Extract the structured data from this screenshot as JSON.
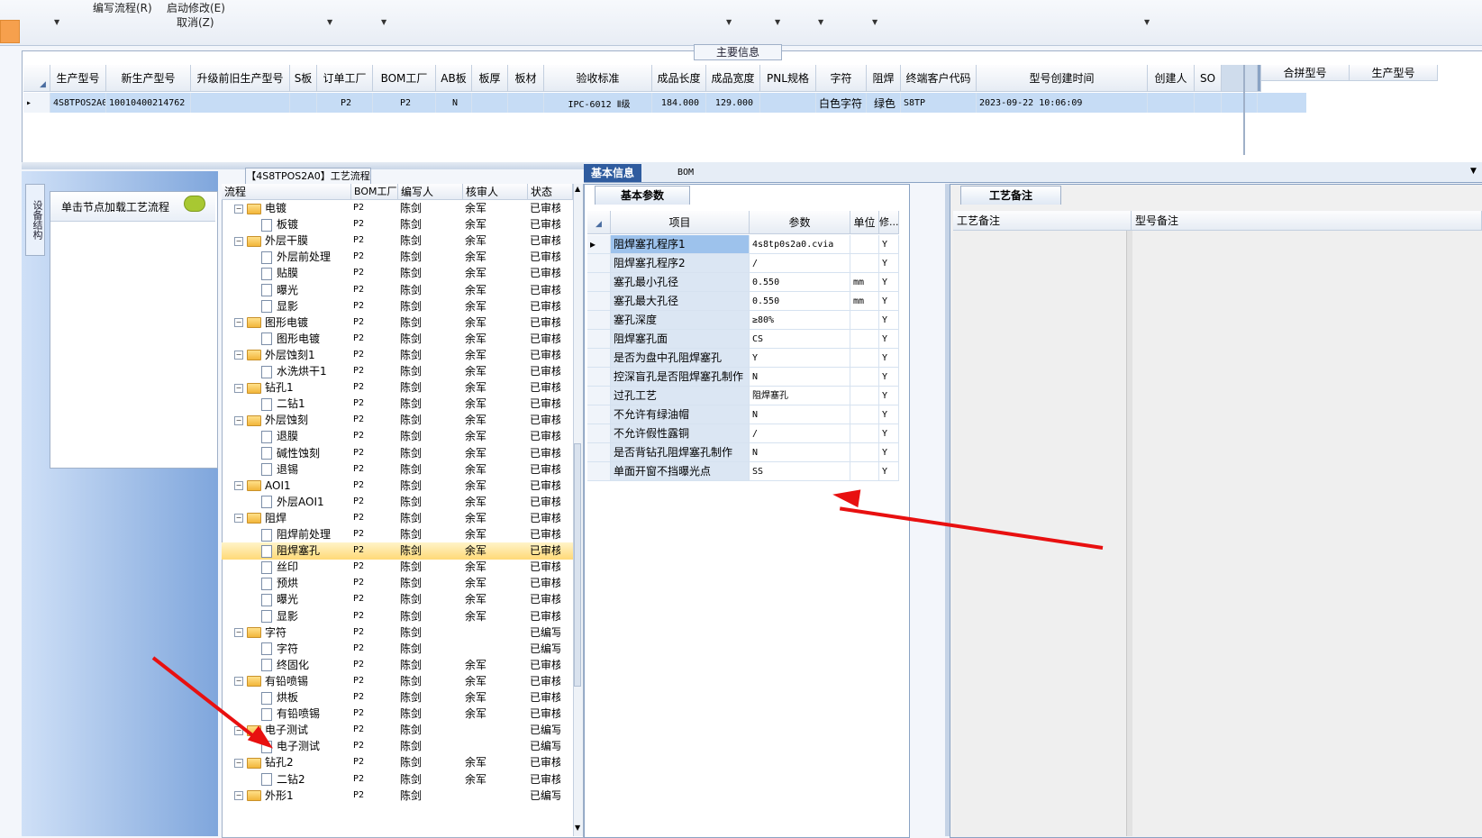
{
  "toolbar": {
    "items": [
      "编写流程(R)",
      "启动修改(E)",
      "取消(Z)"
    ]
  },
  "main_info": {
    "title": "主要信息",
    "columns": [
      "生产型号",
      "新生产型号",
      "升级前旧生产型号",
      "S板",
      "订单工厂",
      "BOM工厂",
      "AB板",
      "板厚",
      "板材",
      "验收标准",
      "成品长度",
      "成品宽度",
      "PNL规格",
      "字符",
      "阻焊",
      "终端客户代码",
      "型号创建时间",
      "创建人",
      "SO"
    ],
    "row": [
      "4S8TPOS2A0",
      "10010400214762",
      "",
      "",
      "P2",
      "P2",
      "N",
      "",
      "",
      "IPC-6012 Ⅱ级",
      "184.000",
      "129.000",
      "",
      "白色字符",
      "绿色",
      "S8TP",
      "2023-09-22 10:06:09",
      "",
      ""
    ],
    "side_columns": [
      "合拼型号",
      "生产型号"
    ]
  },
  "left_panel": {
    "vertical_tab": "设备结构",
    "load_hint": "单击节点加载工艺流程",
    "hint_icon": "speech-bubble-icon"
  },
  "process_tree": {
    "title": "【4S8TPOS2A0】工艺流程",
    "columns": [
      "流程",
      "BOM工厂",
      "编写人",
      "核审人",
      "状态"
    ],
    "rows": [
      {
        "kind": "folder",
        "name": "电镀",
        "bom": "P2",
        "writer": "陈剑",
        "reviewer": "余军",
        "status": "已审核"
      },
      {
        "kind": "doc",
        "name": "板镀",
        "bom": "P2",
        "writer": "陈剑",
        "reviewer": "余军",
        "status": "已审核"
      },
      {
        "kind": "folder",
        "name": "外层干膜",
        "bom": "P2",
        "writer": "陈剑",
        "reviewer": "余军",
        "status": "已审核"
      },
      {
        "kind": "doc",
        "name": "外层前处理",
        "bom": "P2",
        "writer": "陈剑",
        "reviewer": "余军",
        "status": "已审核"
      },
      {
        "kind": "doc",
        "name": "贴膜",
        "bom": "P2",
        "writer": "陈剑",
        "reviewer": "余军",
        "status": "已审核"
      },
      {
        "kind": "doc",
        "name": "曝光",
        "bom": "P2",
        "writer": "陈剑",
        "reviewer": "余军",
        "status": "已审核"
      },
      {
        "kind": "doc",
        "name": "显影",
        "bom": "P2",
        "writer": "陈剑",
        "reviewer": "余军",
        "status": "已审核"
      },
      {
        "kind": "folder",
        "name": "图形电镀",
        "bom": "P2",
        "writer": "陈剑",
        "reviewer": "余军",
        "status": "已审核"
      },
      {
        "kind": "doc",
        "name": "图形电镀",
        "bom": "P2",
        "writer": "陈剑",
        "reviewer": "余军",
        "status": "已审核"
      },
      {
        "kind": "folder",
        "name": "外层蚀刻1",
        "bom": "P2",
        "writer": "陈剑",
        "reviewer": "余军",
        "status": "已审核"
      },
      {
        "kind": "doc",
        "name": "水洗烘干1",
        "bom": "P2",
        "writer": "陈剑",
        "reviewer": "余军",
        "status": "已审核"
      },
      {
        "kind": "folder",
        "name": "钻孔1",
        "bom": "P2",
        "writer": "陈剑",
        "reviewer": "余军",
        "status": "已审核"
      },
      {
        "kind": "doc",
        "name": "二钻1",
        "bom": "P2",
        "writer": "陈剑",
        "reviewer": "余军",
        "status": "已审核"
      },
      {
        "kind": "folder",
        "name": "外层蚀刻",
        "bom": "P2",
        "writer": "陈剑",
        "reviewer": "余军",
        "status": "已审核"
      },
      {
        "kind": "doc",
        "name": "退膜",
        "bom": "P2",
        "writer": "陈剑",
        "reviewer": "余军",
        "status": "已审核"
      },
      {
        "kind": "doc",
        "name": "碱性蚀刻",
        "bom": "P2",
        "writer": "陈剑",
        "reviewer": "余军",
        "status": "已审核"
      },
      {
        "kind": "doc",
        "name": "退锡",
        "bom": "P2",
        "writer": "陈剑",
        "reviewer": "余军",
        "status": "已审核"
      },
      {
        "kind": "folder",
        "name": "AOI1",
        "bom": "P2",
        "writer": "陈剑",
        "reviewer": "余军",
        "status": "已审核"
      },
      {
        "kind": "doc",
        "name": "外层AOI1",
        "bom": "P2",
        "writer": "陈剑",
        "reviewer": "余军",
        "status": "已审核"
      },
      {
        "kind": "folder",
        "name": "阻焊",
        "bom": "P2",
        "writer": "陈剑",
        "reviewer": "余军",
        "status": "已审核"
      },
      {
        "kind": "doc",
        "name": "阻焊前处理",
        "bom": "P2",
        "writer": "陈剑",
        "reviewer": "余军",
        "status": "已审核"
      },
      {
        "kind": "doc",
        "name": "阻焊塞孔",
        "bom": "P2",
        "writer": "陈剑",
        "reviewer": "余军",
        "status": "已审核",
        "selected": true
      },
      {
        "kind": "doc",
        "name": "丝印",
        "bom": "P2",
        "writer": "陈剑",
        "reviewer": "余军",
        "status": "已审核"
      },
      {
        "kind": "doc",
        "name": "预烘",
        "bom": "P2",
        "writer": "陈剑",
        "reviewer": "余军",
        "status": "已审核"
      },
      {
        "kind": "doc",
        "name": "曝光",
        "bom": "P2",
        "writer": "陈剑",
        "reviewer": "余军",
        "status": "已审核"
      },
      {
        "kind": "doc",
        "name": "显影",
        "bom": "P2",
        "writer": "陈剑",
        "reviewer": "余军",
        "status": "已审核"
      },
      {
        "kind": "folder",
        "name": "字符",
        "bom": "P2",
        "writer": "陈剑",
        "reviewer": "",
        "status": "已编写"
      },
      {
        "kind": "doc",
        "name": "字符",
        "bom": "P2",
        "writer": "陈剑",
        "reviewer": "",
        "status": "已编写"
      },
      {
        "kind": "doc",
        "name": "终固化",
        "bom": "P2",
        "writer": "陈剑",
        "reviewer": "余军",
        "status": "已审核"
      },
      {
        "kind": "folder",
        "name": "有铅喷锡",
        "bom": "P2",
        "writer": "陈剑",
        "reviewer": "余军",
        "status": "已审核"
      },
      {
        "kind": "doc",
        "name": "烘板",
        "bom": "P2",
        "writer": "陈剑",
        "reviewer": "余军",
        "status": "已审核"
      },
      {
        "kind": "doc",
        "name": "有铅喷锡",
        "bom": "P2",
        "writer": "陈剑",
        "reviewer": "余军",
        "status": "已审核"
      },
      {
        "kind": "folder",
        "name": "电子测试",
        "bom": "P2",
        "writer": "陈剑",
        "reviewer": "",
        "status": "已编写"
      },
      {
        "kind": "doc",
        "name": "电子测试",
        "bom": "P2",
        "writer": "陈剑",
        "reviewer": "",
        "status": "已编写"
      },
      {
        "kind": "folder",
        "name": "钻孔2",
        "bom": "P2",
        "writer": "陈剑",
        "reviewer": "余军",
        "status": "已审核"
      },
      {
        "kind": "doc",
        "name": "二钻2",
        "bom": "P2",
        "writer": "陈剑",
        "reviewer": "余军",
        "status": "已审核"
      },
      {
        "kind": "folder",
        "name": "外形1",
        "bom": "P2",
        "writer": "陈剑",
        "reviewer": "",
        "status": "已编写"
      }
    ]
  },
  "right_tabs": [
    "基本信息",
    "BOM"
  ],
  "basic_params": {
    "tab": "基本参数",
    "columns": [
      "项目",
      "参数",
      "单位",
      "修..."
    ],
    "rows": [
      {
        "item": "阻焊塞孔程序1",
        "value": "4s8tp0s2a0.cvia",
        "unit": "",
        "mod": "Y",
        "selected": true
      },
      {
        "item": "阻焊塞孔程序2",
        "value": "/",
        "unit": "",
        "mod": "Y"
      },
      {
        "item": "塞孔最小孔径",
        "value": "0.550",
        "unit": "mm",
        "mod": "Y"
      },
      {
        "item": "塞孔最大孔径",
        "value": "0.550",
        "unit": "mm",
        "mod": "Y"
      },
      {
        "item": "塞孔深度",
        "value": "≥80%",
        "unit": "",
        "mod": "Y"
      },
      {
        "item": "阻焊塞孔面",
        "value": "CS",
        "unit": "",
        "mod": "Y"
      },
      {
        "item": "是否为盘中孔阻焊塞孔",
        "value": "Y",
        "unit": "",
        "mod": "Y"
      },
      {
        "item": "控深盲孔是否阻焊塞孔制作",
        "value": "N",
        "unit": "",
        "mod": "Y"
      },
      {
        "item": "过孔工艺",
        "value": "阻焊塞孔",
        "unit": "",
        "mod": "Y"
      },
      {
        "item": "不允许有绿油帽",
        "value": "N",
        "unit": "",
        "mod": "Y"
      },
      {
        "item": "不允许假性露铜",
        "value": "/",
        "unit": "",
        "mod": "Y"
      },
      {
        "item": "是否背钻孔阻焊塞孔制作",
        "value": "N",
        "unit": "",
        "mod": "Y"
      },
      {
        "item": "单面开窗不挡曝光点",
        "value": "SS",
        "unit": "",
        "mod": "Y"
      }
    ]
  },
  "process_notes": {
    "tab": "工艺备注",
    "columns": [
      "工艺备注",
      "型号备注"
    ]
  }
}
